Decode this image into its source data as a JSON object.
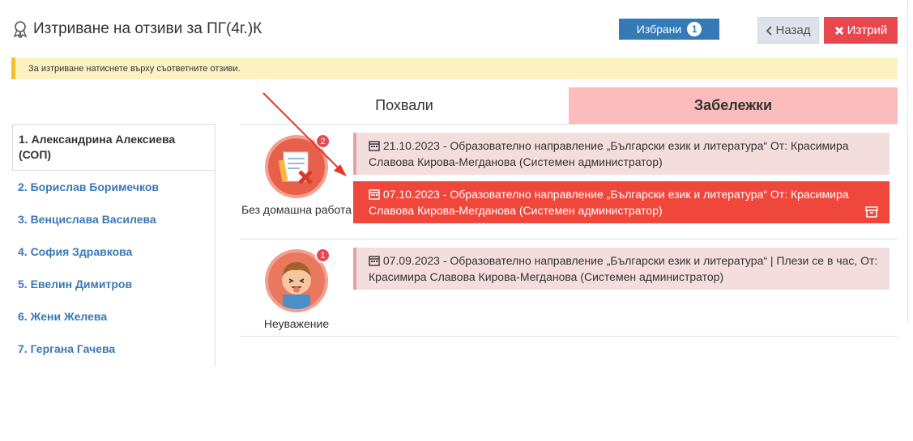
{
  "header": {
    "title": "Изтриване на отзиви за ПГ(4г.)К",
    "icon": "ribbon-icon"
  },
  "toolbar": {
    "selected_label": "Избрани",
    "selected_count": "1",
    "back_label": "Назад",
    "delete_label": "Изтрий"
  },
  "alert": {
    "text": "За изтриване натиснете върху съответните отзиви."
  },
  "students": [
    {
      "label": "1. Александрина Алексиева (СОП)"
    },
    {
      "label": "2. Борислав Боримечков"
    },
    {
      "label": "3. Венцислава Василева"
    },
    {
      "label": "4. София Здравкова"
    },
    {
      "label": "5. Евелин Димитров"
    },
    {
      "label": "6. Жени Желева"
    },
    {
      "label": "7. Гергана Гачева"
    }
  ],
  "tabs": [
    {
      "label": "Похвали"
    },
    {
      "label": "Забележки"
    }
  ],
  "groups": [
    {
      "badge": {
        "label": "Без домашна работа",
        "count": "2",
        "icon": "no-homework-icon"
      },
      "notes": [
        {
          "text": "21.10.2023 - Образователно направление „Български език и литература“ От: Красимира Славова Кирова-Мегданова (Системен администратор)"
        },
        {
          "text": "07.10.2023 - Образователно направление „Български език и литература“ От: Красимира Славова Кирова-Мегданова (Системен администратор)",
          "selected": true
        }
      ]
    },
    {
      "badge": {
        "label": "Неуважение",
        "count": "1",
        "icon": "disrespect-face-icon"
      },
      "notes": [
        {
          "text": "07.09.2023 - Образователно направление „Български език и литература“ | Плези се в час, От: Красимира Славова Кирова-Мегданова (Системен администратор)"
        }
      ]
    }
  ],
  "colors": {
    "accent_blue": "#337ab7",
    "danger": "#e8474f",
    "selected_note": "#f0473c",
    "tab_active": "#fdbcbc",
    "alert_bg": "#fcf1c0"
  }
}
